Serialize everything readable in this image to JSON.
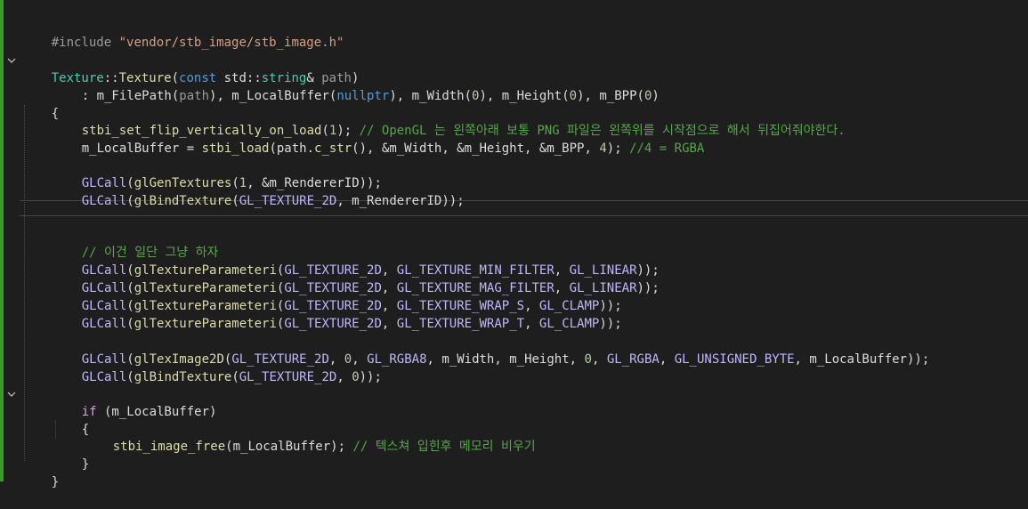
{
  "editor": {
    "lines": {
      "l1": {
        "pp": "#include",
        "sp": " ",
        "str": "\"vendor/stb_image/stb_image.h\""
      },
      "l2": {
        "cls": "Texture",
        "sep": "::",
        "fn": "Texture",
        "open": "(",
        "kw": "const",
        "mid": " std::",
        "typ": "string",
        "amp": "& ",
        "par": "path",
        "close": ")"
      },
      "l3": {
        "a": ": m_FilePath(",
        "p1": "path",
        "b": "), m_LocalBuffer(",
        "k": "nullptr",
        "c": "), m_Width(",
        "n1": "0",
        "d": "), m_Height(",
        "n2": "0",
        "e": "), m_BPP(",
        "n3": "0",
        "f": ")"
      },
      "l4": {
        "t": "{"
      },
      "l5": {
        "fn": "stbi_set_flip_vertically_on_load",
        "a": "(",
        "n": "1",
        "b": "); ",
        "cmt": "// OpenGL 는 왼쪽아래 보통 PNG 파일은 왼쪽위를 시작점으로 해서 뒤집어줘야한다."
      },
      "l6": {
        "a": "m_LocalBuffer = ",
        "fn": "stbi_load",
        "b": "(path.",
        "fn2": "c_str",
        "c": "(), &m_Width, &m_Height, &m_BPP, ",
        "n": "4",
        "d": "); ",
        "cmt": "//4 = RGBA"
      },
      "l7": {
        "mac": "GLCall",
        "a": "(",
        "fn": "glGenTextures",
        "b": "(",
        "n": "1",
        "c": ", &m_RendererID));"
      },
      "l8": {
        "mac": "GLCall",
        "a": "(",
        "fn": "glBindTexture",
        "b": "(",
        "m1": "GL_TEXTURE_2D",
        "c": ", m_RendererID));"
      },
      "l9": {
        "cmt": "// 이건 일단 그냥 하자"
      },
      "l10": {
        "mac": "GLCall",
        "a": "(",
        "fn": "glTextureParameteri",
        "b": "(",
        "m1": "GL_TEXTURE_2D",
        "c": ", ",
        "m2": "GL_TEXTURE_MIN_FILTER",
        "d": ", ",
        "m3": "GL_LINEAR",
        "e": "));"
      },
      "l11": {
        "mac": "GLCall",
        "a": "(",
        "fn": "glTextureParameteri",
        "b": "(",
        "m1": "GL_TEXTURE_2D",
        "c": ", ",
        "m2": "GL_TEXTURE_MAG_FILTER",
        "d": ", ",
        "m3": "GL_LINEAR",
        "e": "));"
      },
      "l12": {
        "mac": "GLCall",
        "a": "(",
        "fn": "glTextureParameteri",
        "b": "(",
        "m1": "GL_TEXTURE_2D",
        "c": ", ",
        "m2": "GL_TEXTURE_WRAP_S",
        "d": ", ",
        "m3": "GL_CLAMP",
        "e": "));"
      },
      "l13": {
        "mac": "GLCall",
        "a": "(",
        "fn": "glTextureParameteri",
        "b": "(",
        "m1": "GL_TEXTURE_2D",
        "c": ", ",
        "m2": "GL_TEXTURE_WRAP_T",
        "d": ", ",
        "m3": "GL_CLAMP",
        "e": "));"
      },
      "l14": {
        "mac": "GLCall",
        "a": "(",
        "fn": "glTexImage2D",
        "b": "(",
        "m1": "GL_TEXTURE_2D",
        "c": ", ",
        "n1": "0",
        "d": ", ",
        "m2": "GL_RGBA8",
        "e": ", m_Width, m_Height, ",
        "n2": "0",
        "f": ", ",
        "m3": "GL_RGBA",
        "g": ", ",
        "m4": "GL_UNSIGNED_BYTE",
        "h": ", m_LocalBuffer));"
      },
      "l15": {
        "mac": "GLCall",
        "a": "(",
        "fn": "glBindTexture",
        "b": "(",
        "m1": "GL_TEXTURE_2D",
        "c": ", ",
        "n": "0",
        "d": "));"
      },
      "l16": {
        "kw": "if",
        "a": " (m_LocalBuffer)"
      },
      "l17": {
        "t": "{"
      },
      "l18": {
        "fn": "stbi_image_free",
        "a": "(m_LocalBuffer); ",
        "cmt": "// 텍스쳐 입힌후 메모리 비우기"
      },
      "l19": {
        "t": "}"
      },
      "l20": {
        "t": "}"
      }
    },
    "colors": {
      "background": "#1e1e1e",
      "modified_bar": "#3a9d23",
      "comment": "#57a64a",
      "function": "#dcdcaa",
      "type": "#4ec9b0",
      "keyword": "#569cd6",
      "macro": "#beb7ff",
      "number": "#b5cea8",
      "string": "#d69d85"
    }
  }
}
